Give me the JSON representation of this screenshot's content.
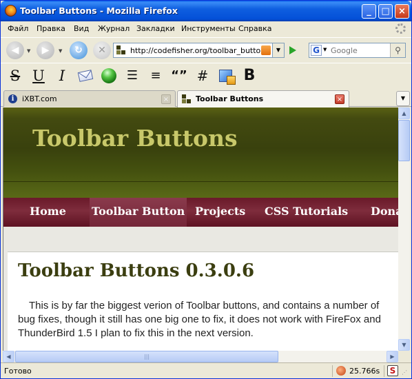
{
  "window": {
    "title": "Toolbar Buttons - Mozilla Firefox"
  },
  "menu": [
    "Файл",
    "Правка",
    "Вид",
    "Журнал",
    "Закладки",
    "Инструменты",
    "Справка"
  ],
  "navbar": {
    "url": "http://codefisher.org/toolbar_button/",
    "search_placeholder": "Google",
    "search_engine_icon": "google-g-icon"
  },
  "format_toolbar": {
    "strike": "S",
    "underline": "U",
    "italic": "I",
    "quote": "“”",
    "hash": "#",
    "bold": "B",
    "icons": [
      "strikethrough-icon",
      "underline-icon",
      "italic-icon",
      "mail-icon",
      "globe-icon",
      "bullet-list-icon",
      "numbered-list-icon",
      "quote-icon",
      "hash-icon",
      "insert-image-icon",
      "bold-icon"
    ]
  },
  "tabs": [
    {
      "label": "iXBT.com",
      "active": false
    },
    {
      "label": "Toolbar Buttons",
      "active": true
    }
  ],
  "page": {
    "site_title": "Toolbar Buttons",
    "nav": [
      {
        "label": "Home"
      },
      {
        "label": "Toolbar Button"
      },
      {
        "label": "Projects"
      },
      {
        "label": "CSS Tutorials"
      },
      {
        "label": "Dona"
      }
    ],
    "article_title": "Toolbar Buttons 0.3.0.6",
    "article_body": "This is by far the biggest verion of Toolbar buttons, and contains a number of bug fixes, though it still has one big one to fix, it does not work with FireFox and ThunderBird 1.5 I plan to fix this in the next version."
  },
  "status": {
    "text": "Готово",
    "timer": "25.766s"
  },
  "colors": {
    "titlebar": "#0a5fe8",
    "site_header": "#3f470f",
    "site_title": "#c8c86a",
    "site_nav": "#742638",
    "article_title": "#3b3e10"
  }
}
